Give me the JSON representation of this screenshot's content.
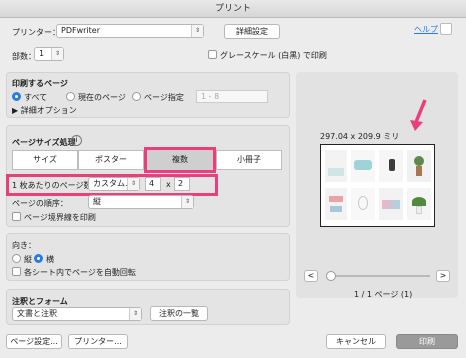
{
  "window": {
    "title": "プリント"
  },
  "printer": {
    "label": "プリンター：",
    "value": "PDFwriter",
    "settings_button": "詳細設定",
    "help": "ヘルプ"
  },
  "copies": {
    "label": "部数：",
    "value": "1"
  },
  "grayscale": {
    "label": "グレースケール (白黒) で印刷"
  },
  "pages": {
    "heading": "印刷するページ",
    "all": "すべて",
    "current": "現在のページ",
    "range": "ページ指定",
    "range_placeholder": "1 - 8",
    "details": "詳細オプション"
  },
  "sizing": {
    "heading": "ページサイズ処理",
    "info": "i",
    "tabs": [
      "サイズ",
      "ポスター",
      "複数",
      "小冊子"
    ],
    "per_sheet_label": "1 枚あたりのページ数：",
    "per_sheet_value": "カスタム...",
    "cols": "4",
    "times": "x",
    "rows": "2",
    "order_label": "ページの順序：",
    "order_value": "縦",
    "border_label": "ページ境界線を印刷"
  },
  "orientation": {
    "heading": "向き：",
    "portrait": "縦",
    "landscape": "横",
    "auto_rotate": "各シート内でページを自動回転"
  },
  "annotations": {
    "heading": "注釈とフォーム",
    "value": "文書と注釈",
    "summary_button": "注釈の一覧"
  },
  "preview": {
    "dimensions": "297.04 x 209.9 ミリ",
    "prev": "<",
    "next": ">",
    "page_status": "1 / 1 ページ (1)",
    "slider_value": 0
  },
  "footer": {
    "page_setup": "ページ設定...",
    "printer": "プリンター...",
    "cancel": "キャンセル",
    "print": "印刷"
  },
  "colors": {
    "accent": "#2b7be4",
    "highlight": "#ea3e7d"
  }
}
